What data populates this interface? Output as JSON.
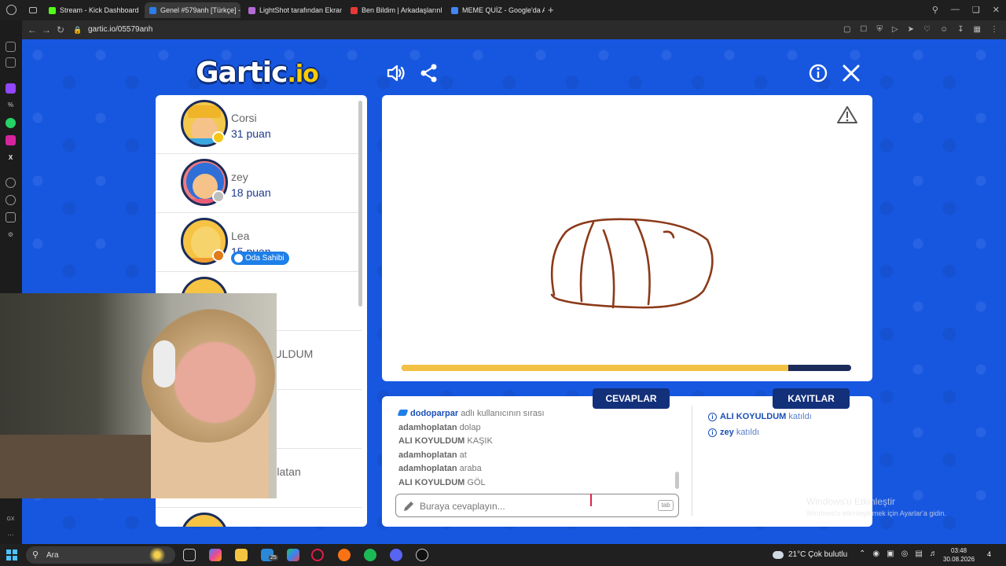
{
  "browser": {
    "tabs": [
      {
        "label": "Stream - Kick Dashboard",
        "color": "#53fc18",
        "active": false
      },
      {
        "label": "Genel #579anh [Türkçe] - ",
        "color": "#2b7de9",
        "active": true
      },
      {
        "label": "LightShot tarafından Ekran",
        "color": "#b36bd6",
        "active": false
      },
      {
        "label": "Ben Bildim | Arkadaşlarınla",
        "color": "#e53935",
        "active": false
      },
      {
        "label": "MEME QUİZ - Google'da Ar",
        "color": "#4285f4",
        "active": false
      }
    ],
    "new_tab": "+",
    "url": "gartic.io/05579anh"
  },
  "game": {
    "logo_main": "Gartic",
    "logo_suffix": ".io",
    "players": [
      {
        "name": "Corsi",
        "score": "31 puan",
        "status_color": "#f5c518",
        "avatar_bg": "#f2c94c",
        "hair": "#f0b429"
      },
      {
        "name": "zey",
        "score": "18 puan",
        "status_color": "#bdbdbd",
        "avatar_bg": "#f07b7b",
        "hair": "#2f6fd8"
      },
      {
        "name": "Lea",
        "score": "15 puan",
        "status_color": "#e07b1a",
        "avatar_bg": "#f6c343",
        "hair": "#f6c343",
        "badge": "Oda Sahibi"
      },
      {
        "name": "",
        "score": ""
      },
      {
        "name": "ALI KOYULDUM",
        "score": ""
      },
      {
        "name": "",
        "score": ""
      },
      {
        "name": "adamhoplatan",
        "score": ""
      }
    ],
    "timer_fraction": 0.86,
    "tabs": {
      "answers": "CEVAPLAR",
      "logs": "KAYITLAR"
    },
    "chat": {
      "turn_user": "dodoparpar",
      "turn_text": "adlı kullanıcının sırası",
      "messages": [
        {
          "user": "adamhoplatan",
          "text": "dolap"
        },
        {
          "user": "ALI KOYULDUM",
          "text": "KAŞIK"
        },
        {
          "user": "adamhoplatan",
          "text": "at"
        },
        {
          "user": "adamhoplatan",
          "text": "araba"
        },
        {
          "user": "ALI KOYULDUM",
          "text": "GÖL"
        }
      ],
      "placeholder": "Buraya cevaplayın...",
      "tab_key": "tab"
    },
    "log": [
      {
        "user": "ALI KOYULDUM",
        "text": "katıldı"
      },
      {
        "user": "zey",
        "text": "katıldı"
      }
    ]
  },
  "watermark": {
    "title": "Windows'u Etkinleştir",
    "subtitle": "Windows'u etkinleştirmek için Ayarlar'a gidin."
  },
  "taskbar": {
    "search_label": "Ara",
    "badge_count": "25",
    "weather": "21°C  Çok bulutlu",
    "time": "03:48",
    "date": "30.08.2026",
    "notif_count": "4"
  }
}
